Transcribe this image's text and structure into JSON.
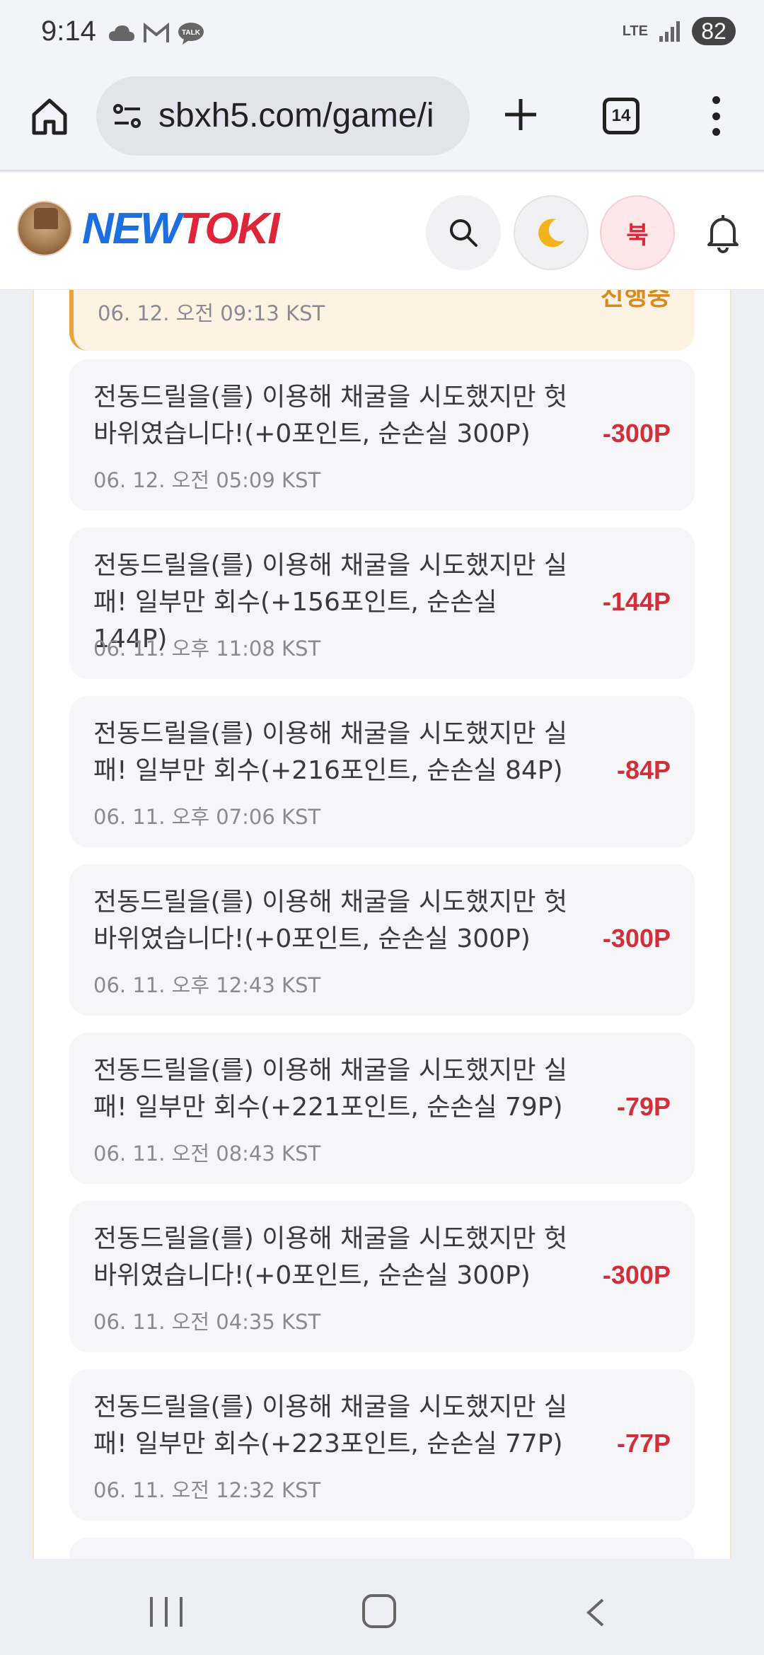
{
  "status_bar": {
    "time": "9:14",
    "network": "LTE",
    "battery": "82"
  },
  "browser": {
    "url": "sbxh5.com/game/i",
    "tab_count": "14"
  },
  "site": {
    "logo_part1": "NEW",
    "logo_part2": "TOKI",
    "book_label": "북"
  },
  "history": {
    "partial_card": {
      "date": "06. 12. 오전 09:13 KST",
      "status": "진행중"
    },
    "items": [
      {
        "message": "전동드릴을(를) 이용해 채굴을 시도했지만 헛바위였습니다!(+0포인트, 순손실 300P)",
        "date": "06. 12. 오전 05:09 KST",
        "amount": "-300P"
      },
      {
        "message": "전동드릴을(를) 이용해 채굴을 시도했지만 실패! 일부만 회수(+156포인트, 순손실 144P)",
        "date": "06. 11. 오후 11:08 KST",
        "amount": "-144P"
      },
      {
        "message": "전동드릴을(를) 이용해 채굴을 시도했지만 실패! 일부만 회수(+216포인트, 순손실 84P)",
        "date": "06. 11. 오후 07:06 KST",
        "amount": "-84P"
      },
      {
        "message": "전동드릴을(를) 이용해 채굴을 시도했지만 헛바위였습니다!(+0포인트, 순손실 300P)",
        "date": "06. 11. 오후 12:43 KST",
        "amount": "-300P"
      },
      {
        "message": "전동드릴을(를) 이용해 채굴을 시도했지만 실패! 일부만 회수(+221포인트, 순손실 79P)",
        "date": "06. 11. 오전 08:43 KST",
        "amount": "-79P"
      },
      {
        "message": "전동드릴을(를) 이용해 채굴을 시도했지만 헛바위였습니다!(+0포인트, 순손실 300P)",
        "date": "06. 11. 오전 04:35 KST",
        "amount": "-300P"
      },
      {
        "message": "전동드릴을(를) 이용해 채굴을 시도했지만 실패! 일부만 회수(+223포인트, 순손실 77P)",
        "date": "06. 11. 오전 12:32 KST",
        "amount": "-77P"
      }
    ]
  },
  "colors": {
    "loss": "#d1303b",
    "logo_blue": "#1c6fe0",
    "logo_red": "#e0243a",
    "pending": "#d98a1e"
  }
}
